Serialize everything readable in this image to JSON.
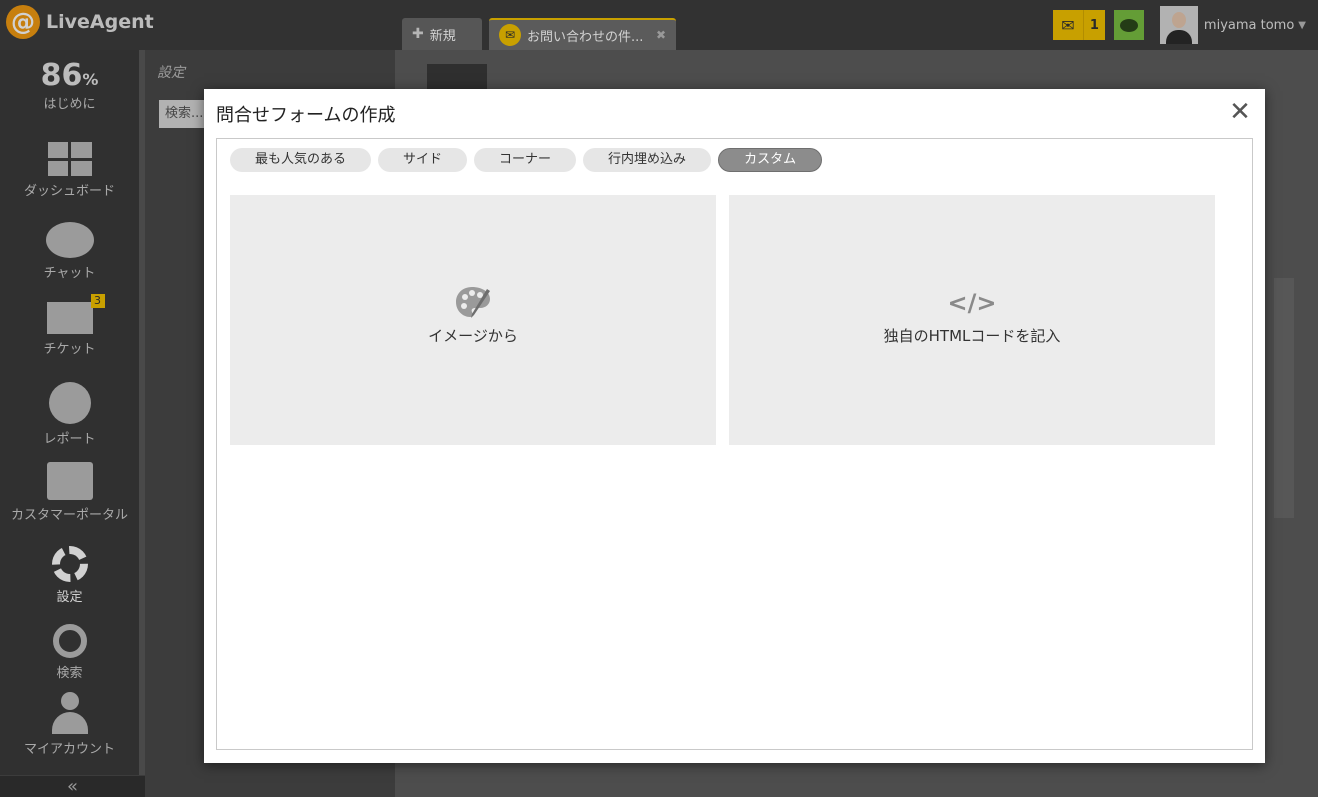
{
  "app": {
    "logo_text": "LiveAgent"
  },
  "tabs": [
    {
      "label": "新規"
    },
    {
      "label": "お問い合わせの件..."
    }
  ],
  "topbar": {
    "mail_count": "1",
    "user_name": "miyama tomo"
  },
  "nav": {
    "progress_value": "86",
    "progress_unit": "%",
    "progress_label": "はじめに",
    "dashboard": "ダッシュボード",
    "chat": "チャット",
    "ticket": "チケット",
    "ticket_badge": "3",
    "report": "レポート",
    "portal": "カスタマーポータル",
    "settings": "設定",
    "search": "検索",
    "account": "マイアカウント",
    "collapse": "«"
  },
  "settings_panel": {
    "title": "設定",
    "search_placeholder": "検索..."
  },
  "modal": {
    "title": "問合せフォームの作成",
    "close": "✕",
    "tabs": [
      {
        "label": "最も人気のある",
        "active": false
      },
      {
        "label": "サイド",
        "active": false
      },
      {
        "label": "コーナー",
        "active": false
      },
      {
        "label": "行内埋め込み",
        "active": false
      },
      {
        "label": "カスタム",
        "active": true
      }
    ],
    "cards": [
      {
        "label": "イメージから",
        "icon": "palette-icon"
      },
      {
        "label": "独自のHTMLコードを記入",
        "icon_text": "</>",
        "icon": "code-icon"
      }
    ]
  },
  "colors": {
    "accent": "#f5c400",
    "chat_green": "#7bc043",
    "logo_orange": "#f39c12"
  }
}
